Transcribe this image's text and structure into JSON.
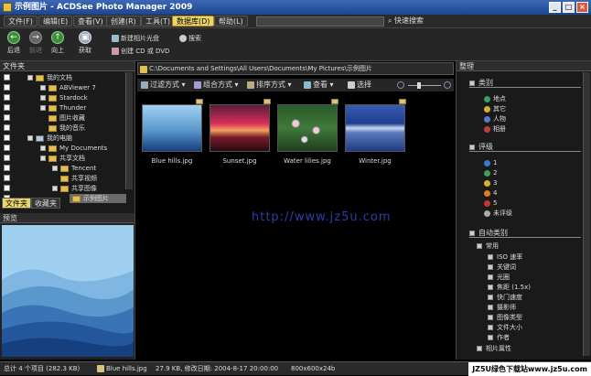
{
  "window": {
    "title": "示例图片 - ACDSee Photo Manager 2009"
  },
  "menu": {
    "items": [
      "文件(F)",
      "编辑(E)",
      "查看(V)",
      "创建(R)",
      "工具(T)",
      "数据库(D)",
      "帮助(L)"
    ],
    "quick_search": "快速搜索"
  },
  "toolbar": {
    "back": "后退",
    "forward": "前进",
    "up": "向上",
    "acquire": "获取",
    "new_album_cd": "新建相片光盘",
    "create_cd_dvd": "创建 CD 或 DVD",
    "search": "搜索"
  },
  "left_panel": {
    "title": "文件夹",
    "tree": [
      "我的文档",
      "ABViewer 7",
      "Stardock",
      "Thunder",
      "图片收藏",
      "我的音乐",
      "我的电脑",
      "My Documents",
      "共享文档",
      "Tencent",
      "共享视频",
      "共享图像",
      "示例图片"
    ],
    "tabs": [
      "文件夹",
      "收藏夹"
    ]
  },
  "preview": {
    "title": "预览"
  },
  "center": {
    "path": "C:\\Documents and Settings\\All Users\\Documents\\My Pictures\\示例图片",
    "filter": "过滤方式",
    "group": "组合方式",
    "sort": "排序方式",
    "view": "查看",
    "select": "选择",
    "thumbnails": [
      {
        "name": "Blue hills.jpg"
      },
      {
        "name": "Sunset.jpg"
      },
      {
        "name": "Water lilies.jpg"
      },
      {
        "name": "Winter.jpg"
      }
    ],
    "watermark": "http://www.jz5u.com"
  },
  "right_panel": {
    "title": "整理",
    "categories_title": "类别",
    "categories": [
      "地点",
      "其它",
      "人物",
      "相册"
    ],
    "ratings_title": "评级",
    "ratings": [
      "1",
      "2",
      "3",
      "4",
      "5",
      "未评级"
    ],
    "auto_title": "自动类别",
    "common": "常用",
    "auto_items": [
      "ISO 速率",
      "关键词",
      "光圈",
      "焦距 (1.5x)",
      "快门速度",
      "摄影师",
      "图像类型",
      "文件大小",
      "作者"
    ],
    "photo_props": "相片属性"
  },
  "status": {
    "total": "总计 4 个项目 (282.3 KB)",
    "file": "Blue hills.jpg",
    "info": "27.9 KB, 修改日期: 2004-8-17 20:00:00",
    "dims": "800x600x24b",
    "brand": "JZ5U绿色下载站www.jz5u.com"
  },
  "colors": {
    "accent": "#ecd56a",
    "titlebar": "#1e4690",
    "watermark": "#2a3fa8"
  }
}
